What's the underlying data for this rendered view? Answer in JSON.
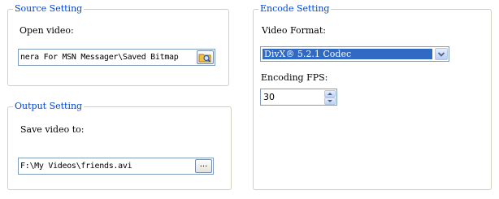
{
  "source": {
    "title": "Source Setting",
    "open_video_label": "Open video:",
    "open_video_value": "nera For MSN Messager\\Saved Bitmap"
  },
  "output": {
    "title": "Output Setting",
    "save_video_label": "Save video to:",
    "save_video_value": "F:\\My Videos\\friends.avi",
    "browse_label": "..."
  },
  "encode": {
    "title": "Encode Setting",
    "format_label": "Video Format:",
    "format_value": "DivX® 5.2.1 Codec",
    "fps_label": "Encoding FPS:",
    "fps_value": "30"
  },
  "icons": {
    "source_browse": "folder-search-icon",
    "combo_dropdown": "chevron-down-icon",
    "spin_up": "arrow-up-icon",
    "spin_down": "arrow-down-icon"
  },
  "colors": {
    "group_title": "#0046d5",
    "selection": "#316ac5",
    "field_border": "#7f9db9",
    "group_border": "#d0d0bf"
  }
}
